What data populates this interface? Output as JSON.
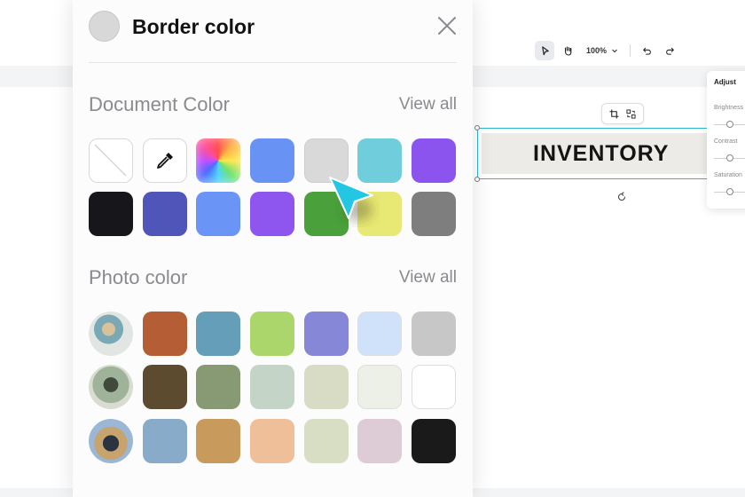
{
  "panel": {
    "title": "Border color",
    "document_section": {
      "title": "Document Color",
      "view_all": "View all"
    },
    "photo_section": {
      "title": "Photo color",
      "view_all": "View all"
    },
    "document_swatches": [
      [
        "none",
        "eyedropper",
        "rainbow",
        "#6893f5",
        "#d9d9d9",
        "#70cddc",
        "#8c54ee"
      ],
      [
        "#17171b",
        "#5055b9",
        "#6a94f5",
        "#8e56ee",
        "#4aa03b",
        "#e8e874",
        "#7e7e7e"
      ]
    ],
    "photo_swatch_rows": [
      {
        "thumbnail": "photo-thumb-1",
        "colors": [
          "#b55d34",
          "#649eb9",
          "#abd66b",
          "#8787d7",
          "#cfe2f9",
          "#c7c7c7"
        ]
      },
      {
        "thumbnail": "photo-thumb-2",
        "colors": [
          "#5d4b30",
          "#879a74",
          "#c4d4c6",
          "#d8dcc4",
          "#edf0e7",
          "#ffffff"
        ]
      },
      {
        "thumbnail": "photo-thumb-3",
        "colors": [
          "#87abc9",
          "#c89a5b",
          "#eebf98",
          "#d7dec4",
          "#ddcbd6",
          "#1a1a1a"
        ]
      }
    ]
  },
  "toolbar": {
    "zoom": "100%"
  },
  "canvas": {
    "text": "INVENTORY"
  },
  "adjust": {
    "title": "Adjust",
    "brightness": "Brightness",
    "contrast": "Contrast",
    "saturation": "Saturation"
  },
  "colors": {
    "accent": "#2eb7cc",
    "cursor": "#23c6e3"
  }
}
